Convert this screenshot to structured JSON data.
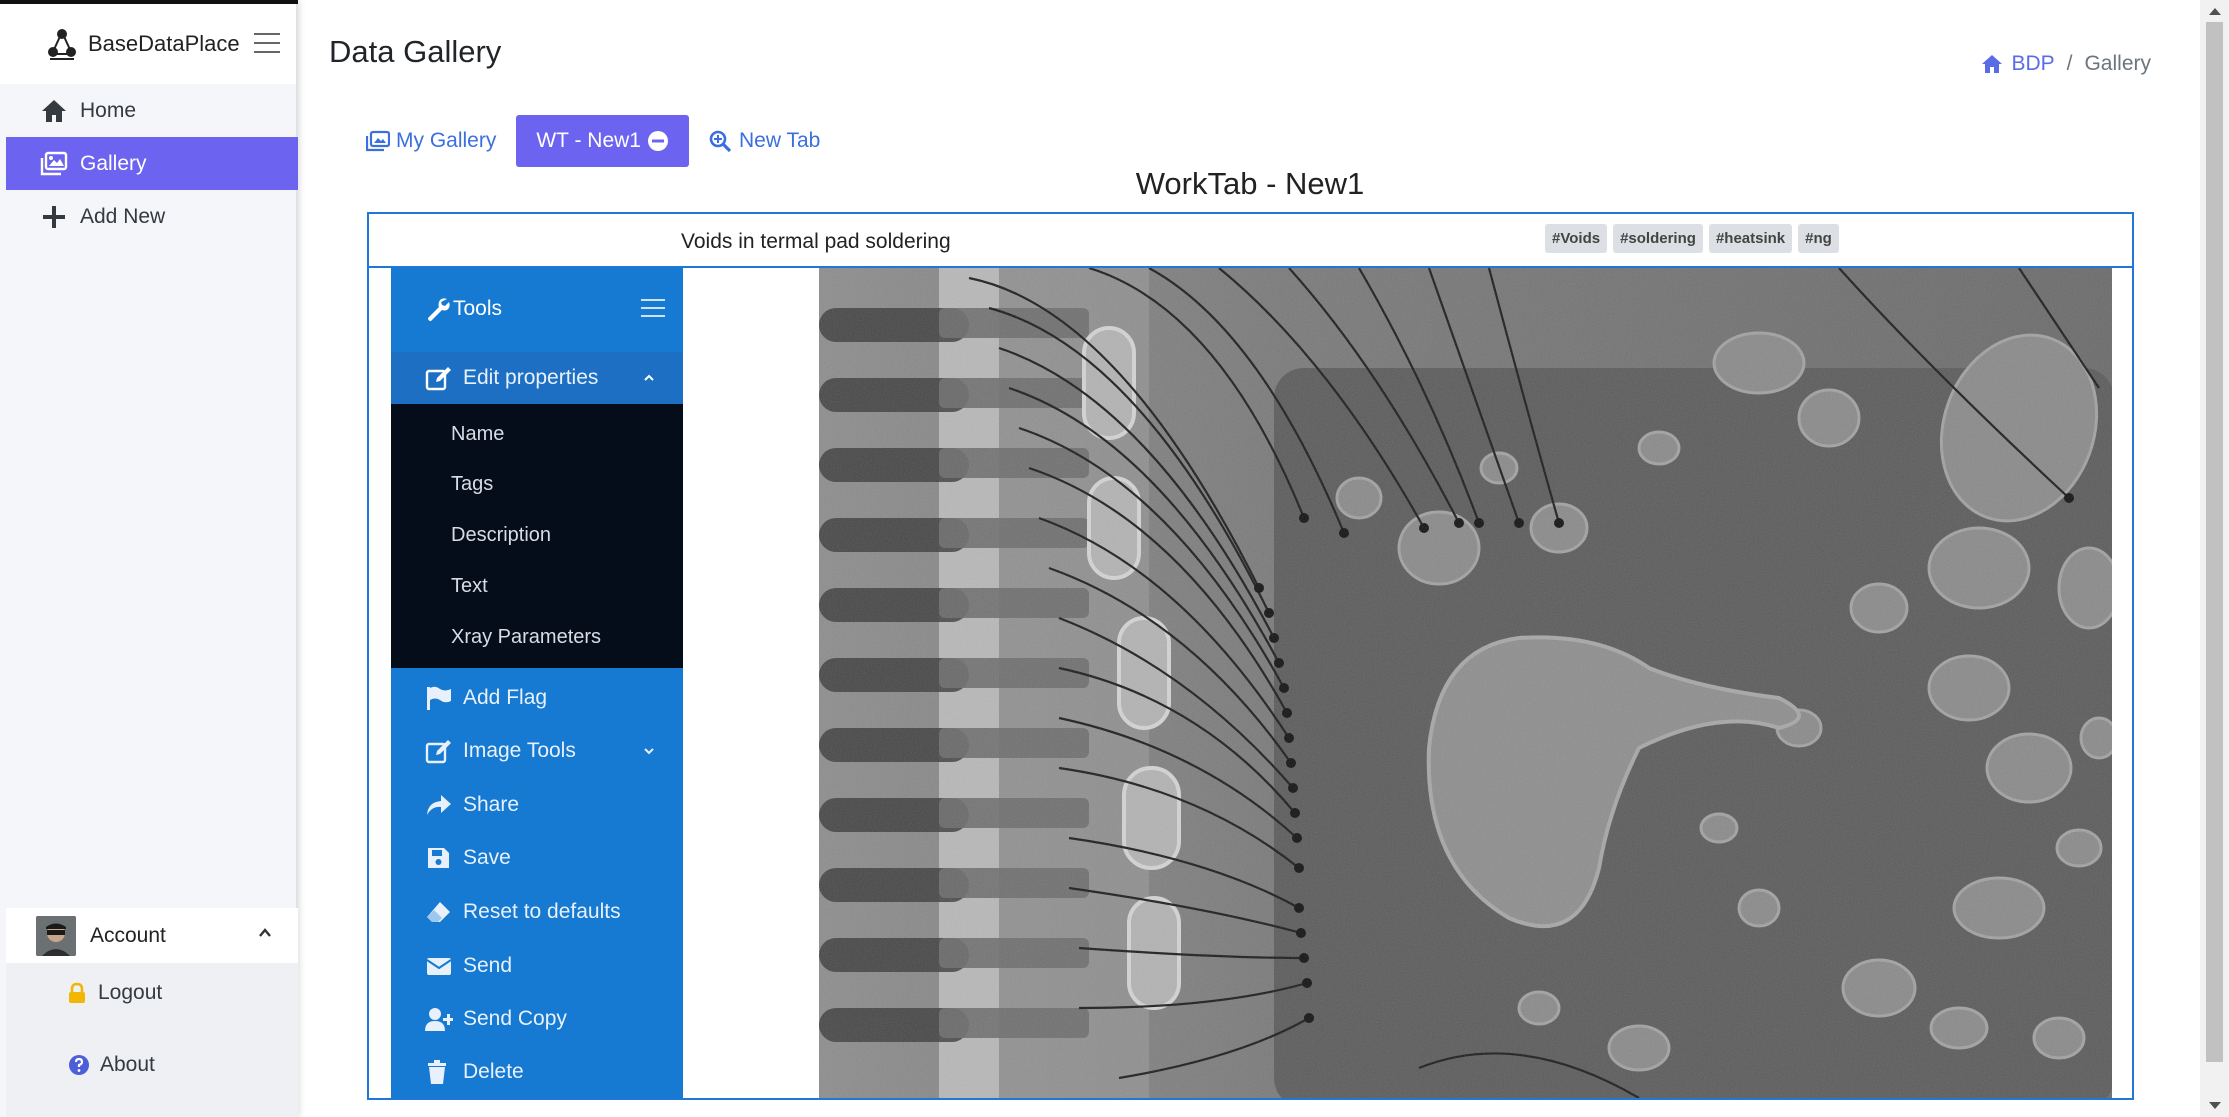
{
  "brand": {
    "name": "BaseDataPlace"
  },
  "sidebar": {
    "items": [
      {
        "label": "Home",
        "icon": "home-icon"
      },
      {
        "label": "Gallery",
        "icon": "gallery-icon",
        "active": true
      },
      {
        "label": "Add New",
        "icon": "plus-icon"
      }
    ],
    "account": {
      "label": "Account"
    },
    "account_menu": [
      {
        "label": "Logout",
        "icon": "lock-icon"
      },
      {
        "label": "About",
        "icon": "question-circle-icon"
      }
    ]
  },
  "header": {
    "title": "Data Gallery",
    "breadcrumb": {
      "root": "BDP",
      "separator": "/",
      "current": "Gallery"
    }
  },
  "tabs": [
    {
      "label": "My Gallery",
      "icon": "images-icon"
    },
    {
      "label": "WT - New1",
      "icon": "minus-circle-icon",
      "active": true
    },
    {
      "label": "New Tab",
      "icon": "search-plus-icon"
    }
  ],
  "worktab": {
    "title": "WorkTab - New1",
    "image_name": "Voids in termal pad soldering",
    "tags": [
      "#Voids",
      "#soldering",
      "#heatsink",
      "#ng"
    ]
  },
  "tools": {
    "title": "Tools",
    "edit_properties": {
      "label": "Edit properties",
      "items": [
        "Name",
        "Tags",
        "Description",
        "Text",
        "Xray Parameters"
      ]
    },
    "actions": [
      {
        "label": "Add Flag",
        "icon": "flag-icon"
      },
      {
        "label": "Image Tools",
        "icon": "edit-icon"
      },
      {
        "label": "Share",
        "icon": "share-icon"
      },
      {
        "label": "Save",
        "icon": "save-icon"
      },
      {
        "label": "Reset to defaults",
        "icon": "eraser-icon"
      },
      {
        "label": "Send",
        "icon": "envelope-icon"
      },
      {
        "label": "Send Copy",
        "icon": "user-plus-icon"
      },
      {
        "label": "Delete",
        "icon": "trash-icon"
      }
    ]
  },
  "colors": {
    "accent": "#6c63f0",
    "tools_bg": "#1679d2",
    "submenu_bg": "#050d1a",
    "link": "#3b6fe0"
  }
}
